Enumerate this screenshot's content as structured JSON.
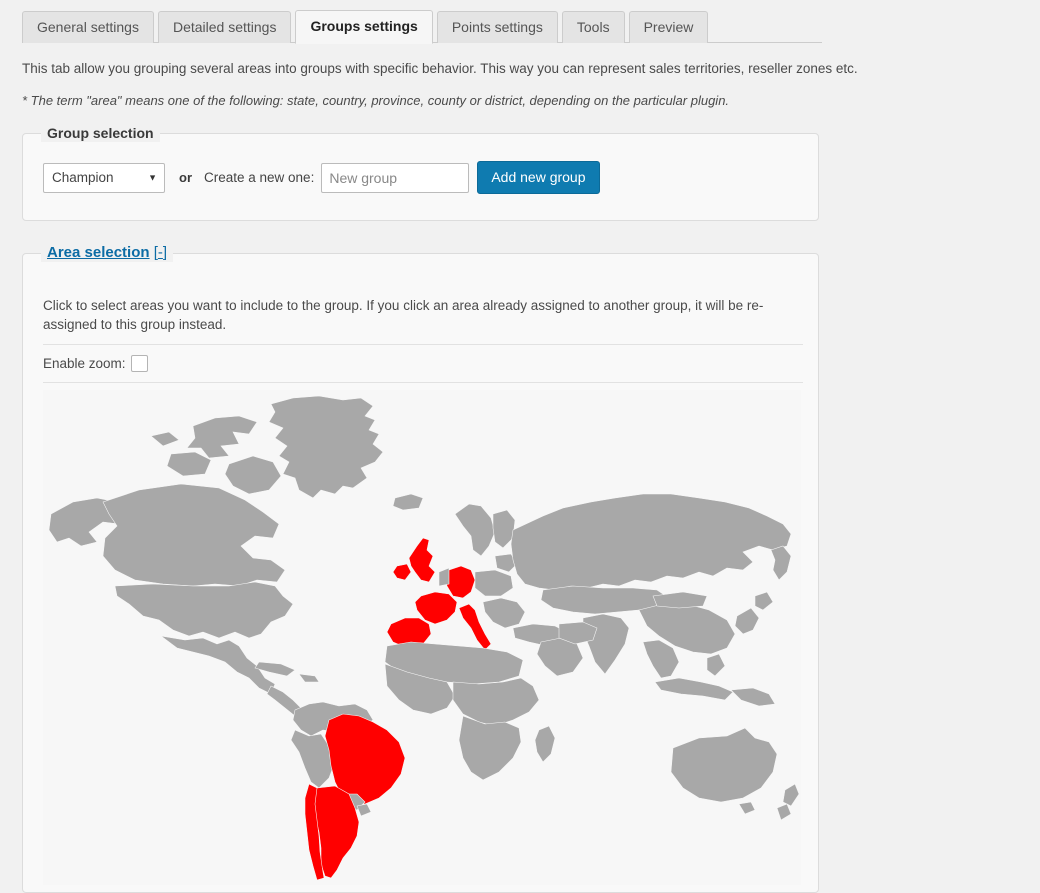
{
  "tabs": [
    {
      "label": "General settings",
      "active": false
    },
    {
      "label": "Detailed settings",
      "active": false
    },
    {
      "label": "Groups settings",
      "active": true
    },
    {
      "label": "Points settings",
      "active": false
    },
    {
      "label": "Tools",
      "active": false
    },
    {
      "label": "Preview",
      "active": false
    }
  ],
  "intro": {
    "description": "This tab allow you grouping several areas into groups with specific behavior. This way you can represent sales territories, reseller zones etc.",
    "note": "* The term \"area\" means one of the following: state, country, province, county or district, depending on the particular plugin."
  },
  "group_selection": {
    "legend": "Group selection",
    "selected_group": "Champion",
    "options": [
      "Champion"
    ],
    "caret_icon": "chevron-down-icon",
    "or_label": "or",
    "create_label": "Create a new one:",
    "new_group_value": "",
    "new_group_placeholder": "New group",
    "add_button_label": "Add new group"
  },
  "area_selection": {
    "legend_title": "Area selection",
    "legend_bracket_open": "[",
    "legend_collapse": "-",
    "legend_bracket_close": "]",
    "description": "Click to select areas you want to include to the group. If you click an area already assigned to another group, it will be re-assigned to this group instead.",
    "enable_zoom_label": "Enable zoom:",
    "enable_zoom_checked": false,
    "map": {
      "land_color": "#a8a8a8",
      "selected_color": "#ff0000",
      "background_color": "#f7f7f7",
      "border_color": "#f7f7f7",
      "selected_areas": [
        "United Kingdom",
        "France",
        "Germany",
        "Spain",
        "Italy",
        "Brazil",
        "Argentina",
        "Chile"
      ]
    }
  },
  "colors": {
    "page_background": "#f1f1f1",
    "panel_background": "#f9f9f9",
    "accent_blue": "#0f7bb0",
    "link_blue": "#0c6ca5",
    "tab_inactive": "#e4e4e4",
    "tab_active": "#f6f6f6"
  }
}
